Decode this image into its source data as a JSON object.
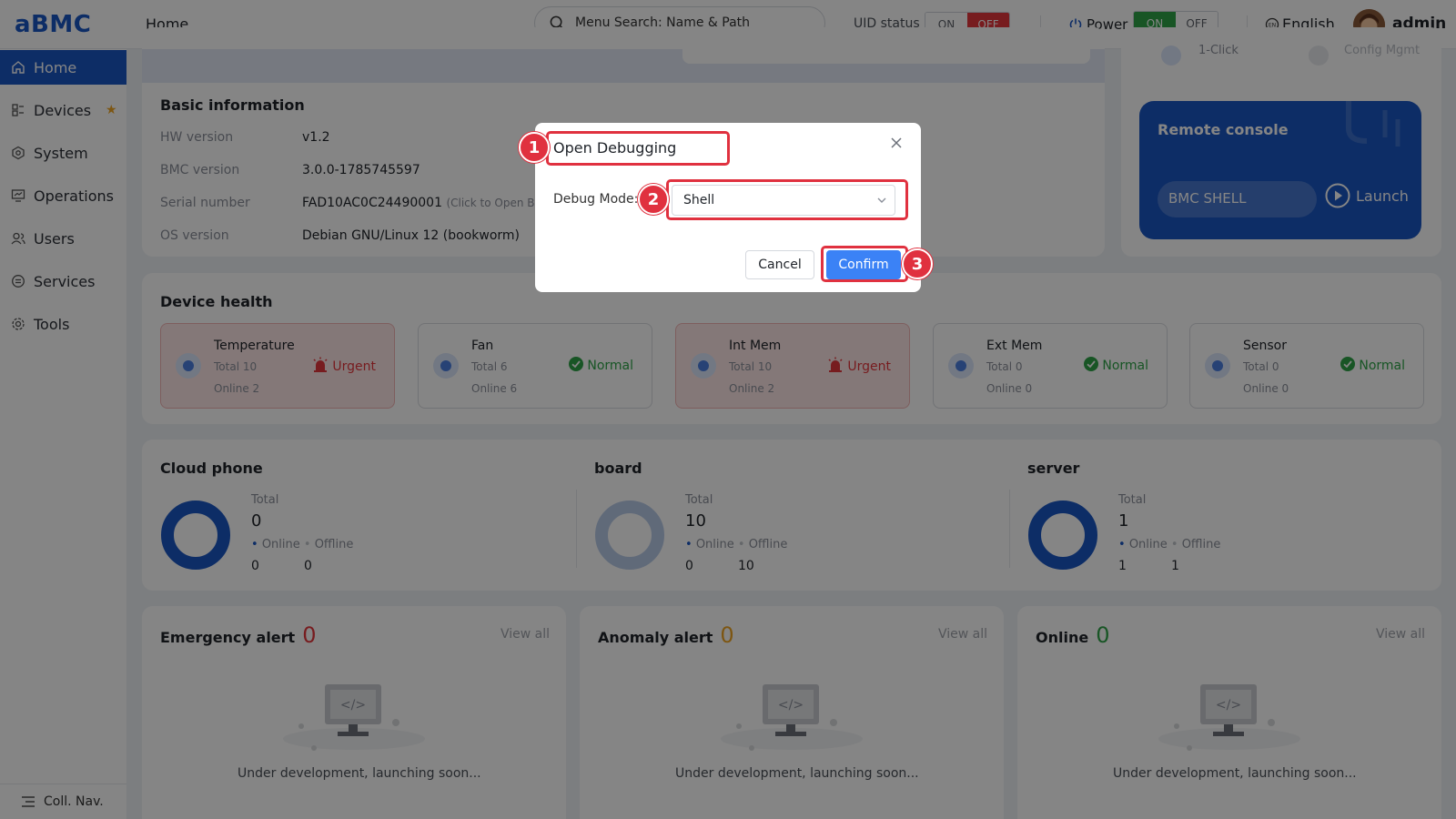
{
  "header": {
    "logo": "aBMC",
    "page_title": "Home",
    "search_placeholder": "Menu Search: Name & Path",
    "uid_label": "UID status",
    "uid_on": "ON",
    "uid_off": "OFF",
    "power_label": "Power",
    "power_on": "ON",
    "power_off": "OFF",
    "language": "English",
    "user": "admin"
  },
  "sidebar": {
    "items": [
      {
        "label": "Home",
        "icon": "home-icon",
        "active": true
      },
      {
        "label": "Devices",
        "icon": "devices-icon",
        "starred": true
      },
      {
        "label": "System",
        "icon": "system-icon"
      },
      {
        "label": "Operations",
        "icon": "operations-icon"
      },
      {
        "label": "Users",
        "icon": "users-icon"
      },
      {
        "label": "Services",
        "icon": "services-icon"
      },
      {
        "label": "Tools",
        "icon": "tools-icon"
      }
    ],
    "collapse_label": "Coll. Nav."
  },
  "quick_links": [
    "1-Click",
    "Config Mgmt"
  ],
  "basic_info": {
    "title": "Basic information",
    "rows": [
      {
        "key": "HW version",
        "value": "v1.2"
      },
      {
        "key": "BMC version",
        "value": "3.0.0-1785745597"
      },
      {
        "key": "Serial number",
        "value": "FAD10AC0C24490001",
        "hint": "(Click to Open Barc"
      },
      {
        "key": "OS version",
        "value": "Debian GNU/Linux 12 (bookworm)"
      }
    ]
  },
  "remote_console": {
    "title": "Remote console",
    "shell_label": "BMC SHELL",
    "launch_label": "Launch"
  },
  "device_health": {
    "title": "Device health",
    "items": [
      {
        "name": "Temperature",
        "total": "Total 10",
        "online": "Online 2",
        "status": "Urgent",
        "level": "urgent"
      },
      {
        "name": "Fan",
        "total": "Total 6",
        "online": "Online 6",
        "status": "Normal",
        "level": "normal"
      },
      {
        "name": "Int Mem",
        "total": "Total 10",
        "online": "Online 2",
        "status": "Urgent",
        "level": "urgent"
      },
      {
        "name": "Ext Mem",
        "total": "Total 0",
        "online": "Online 0",
        "status": "Normal",
        "level": "normal"
      },
      {
        "name": "Sensor",
        "total": "Total 0",
        "online": "Online 0",
        "status": "Normal",
        "level": "normal"
      }
    ]
  },
  "summary": {
    "total_label": "Total",
    "online_label": "Online",
    "offline_label": "Offline",
    "groups": [
      {
        "title": "Cloud phone",
        "total": "0",
        "online": "0",
        "offline": "0",
        "ring_color": "#1a56c4"
      },
      {
        "title": "board",
        "total": "10",
        "online": "0",
        "offline": "10",
        "ring_color": "#b9cbe9"
      },
      {
        "title": "server",
        "total": "1",
        "online": "1",
        "offline": "1",
        "ring_color": "#1a56c4"
      }
    ]
  },
  "alerts": [
    {
      "title": "Emergency alert",
      "count": "0",
      "color": "#e5363c",
      "view_all": "View all",
      "note": "Under development, launching soon..."
    },
    {
      "title": "Anomaly alert",
      "count": "0",
      "color": "#f0a623",
      "view_all": "View all",
      "note": "Under development, launching soon..."
    },
    {
      "title": "Online",
      "count": "0",
      "color": "#2ea448",
      "view_all": "View all",
      "note": "Under development, launching soon..."
    }
  ],
  "dialog": {
    "title": "Open Debugging",
    "debug_mode_label": "Debug Mode:",
    "debug_mode_value": "Shell",
    "cancel_label": "Cancel",
    "confirm_label": "Confirm"
  },
  "callouts": [
    "1",
    "2",
    "3"
  ],
  "colors": {
    "brand": "#1a56c4",
    "urgent": "#e5363c",
    "normal": "#2ea448",
    "callout": "#e0313f",
    "confirm": "#3b82f6"
  }
}
